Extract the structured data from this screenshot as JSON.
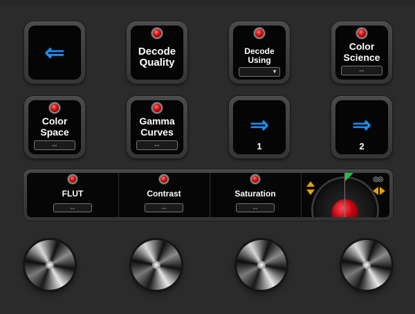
{
  "row1": [
    {
      "type": "arrow",
      "glyph": "⇐"
    },
    {
      "type": "label",
      "lines": [
        "Decode",
        "Quality"
      ],
      "led": true
    },
    {
      "type": "label-dropdown",
      "lines": [
        "Decode",
        "Using"
      ],
      "led": true,
      "dropdown": "▼"
    },
    {
      "type": "label-toggle",
      "lines": [
        "Color",
        "Science"
      ],
      "led": true,
      "toggle": "↔"
    }
  ],
  "row2": [
    {
      "type": "label-toggle",
      "lines": [
        "Color",
        "Space"
      ],
      "led": true,
      "toggle": "↔"
    },
    {
      "type": "label-toggle",
      "lines": [
        "Gamma",
        "Curves"
      ],
      "led": true,
      "toggle": "↔"
    },
    {
      "type": "arrow-num",
      "glyph": "⇒",
      "num": "1"
    },
    {
      "type": "arrow-num",
      "glyph": "⇒",
      "num": "2"
    }
  ],
  "bar": {
    "segments": [
      {
        "label": "FLUT",
        "toggle": "↔"
      },
      {
        "label": "Contrast",
        "toggle": "↔"
      },
      {
        "label": "Saturation",
        "toggle": "↔"
      }
    ],
    "rings": "◎◎"
  },
  "colors": {
    "accent": "#1e8cf0",
    "led": "#e01010",
    "jog_indicator": "#e3a100",
    "jog_flag": "#22c04a"
  },
  "icons": {
    "back": "double-arrow-left-icon",
    "forward": "double-arrow-right-icon",
    "toggle": "left-right-arrow-icon"
  }
}
